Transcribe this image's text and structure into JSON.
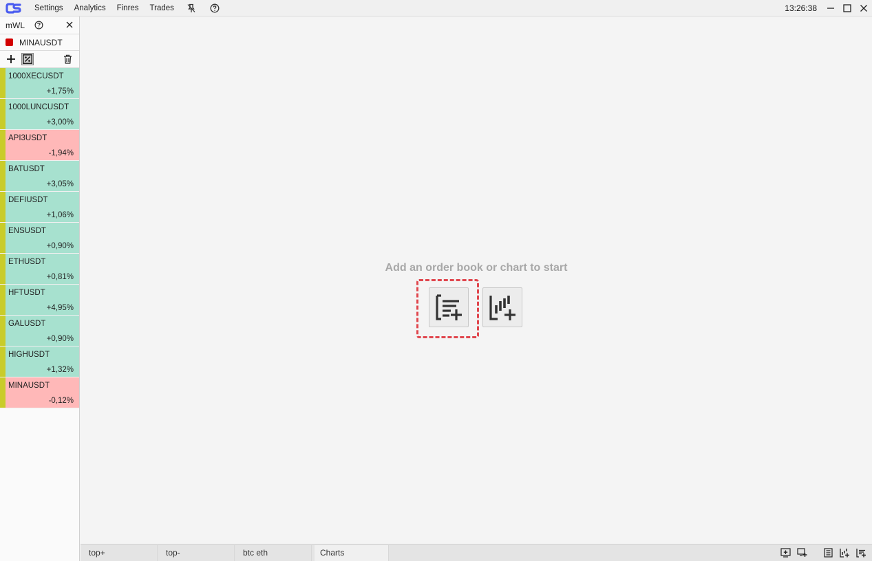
{
  "titlebar": {
    "menu": [
      "Settings",
      "Analytics",
      "Finres",
      "Trades"
    ],
    "clock": "13:26:38",
    "logo_color": "#4a5cf0"
  },
  "left_panel": {
    "title": "mWL",
    "selected_symbol": "MINAUSDT",
    "selected_color": "#d30000",
    "items": [
      {
        "name": "1000XECUSDT",
        "change": "+1,75%",
        "dir": "up"
      },
      {
        "name": "1000LUNCUSDT",
        "change": "+3,00%",
        "dir": "up"
      },
      {
        "name": "API3USDT",
        "change": "-1,94%",
        "dir": "down"
      },
      {
        "name": "BATUSDT",
        "change": "+3,05%",
        "dir": "up"
      },
      {
        "name": "DEFIUSDT",
        "change": "+1,06%",
        "dir": "up"
      },
      {
        "name": "ENSUSDT",
        "change": "+0,90%",
        "dir": "up"
      },
      {
        "name": "ETHUSDT",
        "change": "+0,81%",
        "dir": "up"
      },
      {
        "name": "HFTUSDT",
        "change": "+4,95%",
        "dir": "up"
      },
      {
        "name": "GALUSDT",
        "change": "+0,90%",
        "dir": "up"
      },
      {
        "name": "HIGHUSDT",
        "change": "+1,32%",
        "dir": "up"
      },
      {
        "name": "MINAUSDT",
        "change": "-0,12%",
        "dir": "down"
      }
    ]
  },
  "main": {
    "prompt": "Add an order book or chart to start",
    "highlight_color": "#e0464d"
  },
  "bottom": {
    "tabs": [
      "top+",
      "top-",
      "btc eth",
      "Charts"
    ],
    "active_tab": "Charts"
  },
  "colors": {
    "up_bg": "#a7e1cf",
    "down_bg": "#ffb8b8",
    "side_bar": "#c9cc2a"
  }
}
